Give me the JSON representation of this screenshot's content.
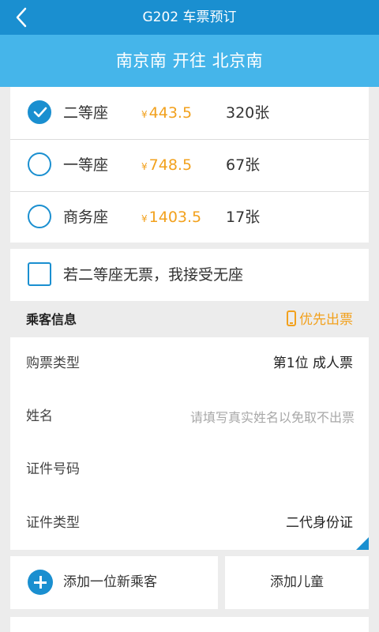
{
  "header": {
    "title": "G202 车票预订",
    "back_icon": "chevron-left-icon"
  },
  "route": {
    "text": "南京南 开往 北京南"
  },
  "seats": [
    {
      "name": "二等座",
      "currency": "¥",
      "price": "443.5",
      "count": "320张",
      "selected": true
    },
    {
      "name": "一等座",
      "currency": "¥",
      "price": "748.5",
      "count": "67张",
      "selected": false
    },
    {
      "name": "商务座",
      "currency": "¥",
      "price": "1403.5",
      "count": "17张",
      "selected": false
    }
  ],
  "accept_no_seat": {
    "label": "若二等座无票，我接受无座",
    "checked": false
  },
  "passenger": {
    "section_title": "乘客信息",
    "priority_label": "优先出票",
    "fields": {
      "ticket_type": {
        "label": "购票类型",
        "value": "第1位  成人票"
      },
      "name": {
        "label": "姓名",
        "value": "",
        "placeholder": "请填写真实姓名以免取不出票"
      },
      "id_number": {
        "label": "证件号码",
        "value": ""
      },
      "id_type": {
        "label": "证件类型",
        "value": "二代身份证"
      }
    }
  },
  "actions": {
    "add_passenger": "添加一位新乘客",
    "add_child": "添加儿童"
  },
  "colors": {
    "primary": "#1a8fd0",
    "route_bar": "#45b5ea",
    "accent": "#f2a11d",
    "background": "#ececec"
  }
}
